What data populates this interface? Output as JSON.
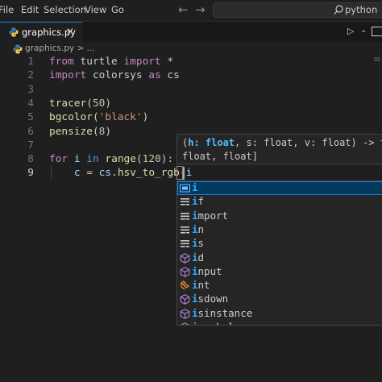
{
  "menu": [
    "File",
    "Edit",
    "Selection",
    "View",
    "Go"
  ],
  "nav": {
    "back": "←",
    "forward": "→"
  },
  "search": {
    "text": "python"
  },
  "tab": {
    "label": "graphics.py",
    "close": "✕"
  },
  "toolbar": {
    "run": "▷",
    "run_dropdown": "⌄"
  },
  "breadcrumb": {
    "file": "graphics.py",
    "separator": ">",
    "more": "..."
  },
  "editor": {
    "line_numbers": [
      "1",
      "2",
      "3",
      "4",
      "5",
      "6",
      "7",
      "8",
      "9"
    ],
    "active_line": "9",
    "lines": [
      [
        {
          "t": "from",
          "c": "k"
        },
        {
          "t": " turtle ",
          "c": ""
        },
        {
          "t": "import",
          "c": "k"
        },
        {
          "t": " *",
          "c": ""
        }
      ],
      [
        {
          "t": "import",
          "c": "k"
        },
        {
          "t": " colorsys ",
          "c": ""
        },
        {
          "t": "as",
          "c": "k"
        },
        {
          "t": " cs",
          "c": ""
        }
      ],
      [],
      [
        {
          "t": "tracer",
          "c": "f"
        },
        {
          "t": "(",
          "c": ""
        },
        {
          "t": "50",
          "c": "n"
        },
        {
          "t": ")",
          "c": ""
        }
      ],
      [
        {
          "t": "bgcolor",
          "c": "f"
        },
        {
          "t": "(",
          "c": ""
        },
        {
          "t": "'black'",
          "c": "s"
        },
        {
          "t": ")",
          "c": ""
        }
      ],
      [
        {
          "t": "pensize",
          "c": "f"
        },
        {
          "t": "(",
          "c": ""
        },
        {
          "t": "8",
          "c": "n"
        },
        {
          "t": ")",
          "c": ""
        }
      ],
      [],
      [
        {
          "t": "for",
          "c": "k"
        },
        {
          "t": " ",
          "c": ""
        },
        {
          "t": "i",
          "c": "v"
        },
        {
          "t": " ",
          "c": ""
        },
        {
          "t": "in",
          "c": "kb"
        },
        {
          "t": " ",
          "c": ""
        },
        {
          "t": "range",
          "c": "f"
        },
        {
          "t": "(",
          "c": ""
        },
        {
          "t": "120",
          "c": "n"
        },
        {
          "t": "):",
          "c": ""
        }
      ],
      [
        {
          "t": "    ",
          "c": ""
        },
        {
          "t": "c",
          "c": "v"
        },
        {
          "t": " = ",
          "c": ""
        },
        {
          "t": "cs",
          "c": "v"
        },
        {
          "t": ".",
          "c": ""
        },
        {
          "t": "hsv_to_rgb",
          "c": "f"
        },
        {
          "t": "(",
          "c": "paren"
        },
        {
          "t": "i",
          "c": "v"
        }
      ]
    ]
  },
  "signature": {
    "line1_pre": "(",
    "line1_param": "h: float",
    "line1_post": ", s: float, v: float) -> tu",
    "line2": "float, float]"
  },
  "suggestions": [
    {
      "label": "i",
      "kind": "variable"
    },
    {
      "label": "if",
      "kind": "keyword"
    },
    {
      "label": "import",
      "kind": "keyword"
    },
    {
      "label": "in",
      "kind": "keyword"
    },
    {
      "label": "is",
      "kind": "keyword"
    },
    {
      "label": "id",
      "kind": "function"
    },
    {
      "label": "input",
      "kind": "function"
    },
    {
      "label": "int",
      "kind": "class"
    },
    {
      "label": "isdown",
      "kind": "function"
    },
    {
      "label": "isinstance",
      "kind": "function"
    },
    {
      "label": "issubclass",
      "kind": "function"
    }
  ],
  "suggest_selected_index": 0,
  "match_prefix": "i",
  "colors": {
    "accent": "#0078d4",
    "selected_bg": "#04395e",
    "match": "#2aaaff",
    "keyword": "#c586c0",
    "function": "#dcdcaa",
    "number": "#b5cea8",
    "string": "#ce9178",
    "variable": "#9cdcfe"
  }
}
